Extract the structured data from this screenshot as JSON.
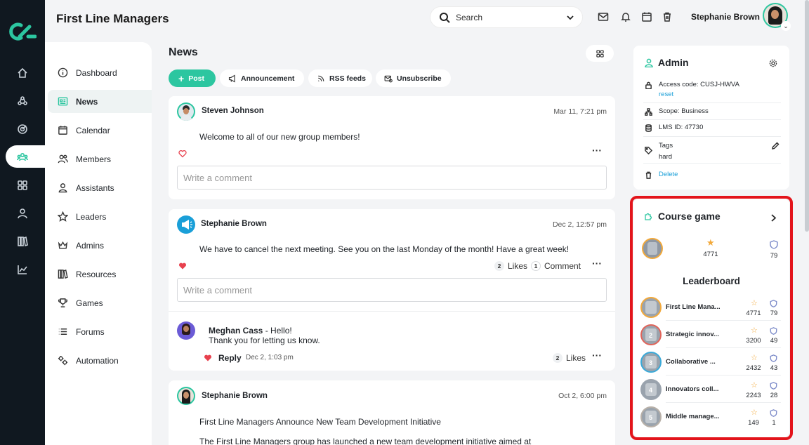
{
  "app": {
    "group_title": "First Line Managers",
    "page_title": "News"
  },
  "search": {
    "label": "Search"
  },
  "user": {
    "name": "Stephanie Brown"
  },
  "sidebar_nav": [
    {
      "label": "Dashboard",
      "icon": "info-circle-icon"
    },
    {
      "label": "News",
      "icon": "news-icon",
      "active": true
    },
    {
      "label": "Calendar",
      "icon": "calendar-icon"
    },
    {
      "label": "Members",
      "icon": "members-icon"
    },
    {
      "label": "Assistants",
      "icon": "assistant-icon"
    },
    {
      "label": "Leaders",
      "icon": "star-icon"
    },
    {
      "label": "Admins",
      "icon": "crown-icon"
    },
    {
      "label": "Resources",
      "icon": "books-icon"
    },
    {
      "label": "Games",
      "icon": "trophy-icon"
    },
    {
      "label": "Forums",
      "icon": "list-icon"
    },
    {
      "label": "Automation",
      "icon": "automation-icon"
    }
  ],
  "actions": {
    "post": "Post",
    "announcement": "Announcement",
    "rss": "RSS feeds",
    "unsubscribe": "Unsubscribe"
  },
  "posts": [
    {
      "author": "Steven Johnson",
      "date": "Mar 11, 7:21 pm",
      "text": "Welcome to all of our new group members!",
      "comment_placeholder": "Write a comment"
    },
    {
      "author": "Stephanie Brown",
      "date": "Dec 2, 12:57 pm",
      "text": "We have to cancel the next meeting. See you on the last Monday of the month! Have a great week!",
      "likes_count": "2",
      "likes_label": "Likes",
      "comments_count": "1",
      "comments_label": "Comment",
      "comment_placeholder": "Write a comment",
      "reply": {
        "author": "Meghan Cass",
        "line1": " - Hello!",
        "line2": "Thank you for letting us know.",
        "reply_label": "Reply",
        "date": "Dec 2, 1:03 pm",
        "likes_count": "2",
        "likes_label": "Likes"
      }
    },
    {
      "author": "Stephanie Brown",
      "date": "Oct 2, 6:00 pm",
      "text": "First Line Managers Announce New Team Development Initiative",
      "text2": "The First Line Managers group has launched a new team development initiative aimed at"
    }
  ],
  "admin": {
    "title": "Admin",
    "access_code": "Access code: CUSJ-HWVA",
    "reset": "reset",
    "scope": "Scope: Business",
    "lms": "LMS ID: 47730",
    "tags_label": "Tags",
    "tags_value": "hard",
    "delete": "Delete"
  },
  "course_game": {
    "title": "Course game",
    "points": "4771",
    "badges": "79",
    "leaderboard_title": "Leaderboard",
    "leaderboard": [
      {
        "name": "First Line Mana...",
        "points": "4771",
        "badges": "79",
        "rank": "",
        "ring": "#f2a93b"
      },
      {
        "name": "Strategic innov...",
        "points": "3200",
        "badges": "49",
        "rank": "2",
        "ring": "#e0645a"
      },
      {
        "name": "Collaborative ...",
        "points": "2432",
        "badges": "43",
        "rank": "3",
        "ring": "#3aa9d8"
      },
      {
        "name": "Innovators coll...",
        "points": "2243",
        "badges": "28",
        "rank": "4",
        "ring": "#9aa3ad"
      },
      {
        "name": "Middle manage...",
        "points": "149",
        "badges": "1",
        "rank": "5",
        "ring": "#b8b0a8"
      }
    ]
  },
  "colors": {
    "accent": "#2cc6a0",
    "rail": "#101820",
    "highlight": "#e3141b",
    "heart": "#e8414e",
    "link": "#1a9fd8"
  }
}
